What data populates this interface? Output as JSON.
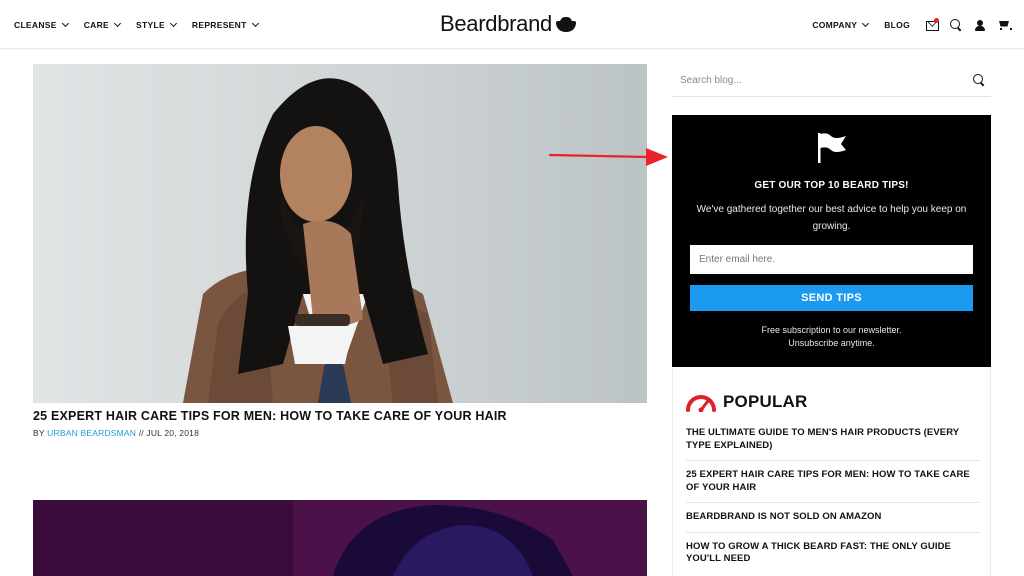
{
  "header": {
    "nav_left": [
      {
        "label": "CLEANSE"
      },
      {
        "label": "CARE"
      },
      {
        "label": "STYLE"
      },
      {
        "label": "REPRESENT"
      }
    ],
    "logo_text": "Beardbrand",
    "nav_right": {
      "company": "COMPANY",
      "blog": "BLOG"
    },
    "icons": [
      "mail-icon",
      "search-icon",
      "account-icon",
      "cart-icon"
    ]
  },
  "posts": [
    {
      "title": "25 EXPERT HAIR CARE TIPS FOR MEN: HOW TO TAKE CARE OF YOUR HAIR",
      "by": "BY",
      "author": "URBAN BEARDSMAN",
      "date": "// JUL 20, 2018"
    }
  ],
  "sidebar": {
    "search_placeholder": "Search blog...",
    "tips": {
      "heading": "GET OUR TOP 10 BEARD TIPS!",
      "body": "We've gathered together our best advice to help you keep on growing.",
      "email_placeholder": "Enter email here.",
      "button": "SEND TIPS",
      "foot_line1": "Free subscription to our newsletter.",
      "foot_line2": "Unsubscribe anytime."
    },
    "popular": {
      "heading": "POPULAR",
      "items": [
        "THE ULTIMATE GUIDE TO MEN'S HAIR PRODUCTS (EVERY TYPE EXPLAINED)",
        "25 EXPERT HAIR CARE TIPS FOR MEN: HOW TO TAKE CARE OF YOUR HAIR",
        "BEARDBRAND IS NOT SOLD ON AMAZON",
        "HOW TO GROW A THICK BEARD FAST: THE ONLY GUIDE YOU'LL NEED"
      ]
    }
  },
  "colors": {
    "accent_blue": "#1b9af0",
    "link_blue": "#1d9ad6",
    "annotation_red": "#e8232b",
    "gauge_red": "#e01f26"
  }
}
